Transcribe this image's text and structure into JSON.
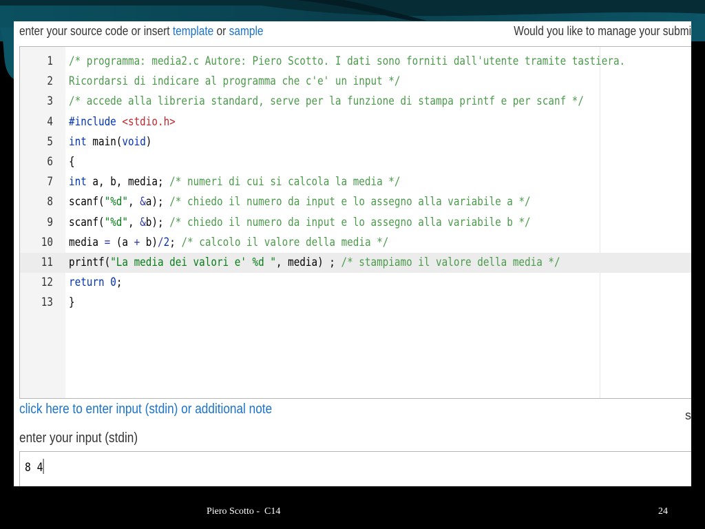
{
  "colors": {
    "background": "#000000",
    "slide_teal": "#0c4a5a",
    "link_blue": "#1a73c9",
    "comment_green": "#4a9a4a",
    "keyword_blue": "#0033b3",
    "string_green": "#067d17",
    "header_red": "#c0262d"
  },
  "top_bar": {
    "prefix": "enter your source code or insert ",
    "template_link": "template",
    "or_text": " or ",
    "sample_link": "sample",
    "right_text": "Would you like to manage your submis"
  },
  "editor": {
    "active_line": 11,
    "lines": [
      {
        "num": "1",
        "tokens": [
          {
            "t": "comment",
            "v": "/* programma: media2.c Autore: Piero Scotto. I dati sono forniti dall'utente tramite tastiera."
          }
        ]
      },
      {
        "num": "2",
        "tokens": [
          {
            "t": "comment",
            "v": "Ricordarsi di indicare al programma che c'e' un input */"
          }
        ]
      },
      {
        "num": "3",
        "tokens": [
          {
            "t": "comment",
            "v": "/* accede alla libreria standard, serve per la funzione di stampa printf e per scanf */"
          }
        ]
      },
      {
        "num": "4",
        "tokens": [
          {
            "t": "preproc",
            "v": "#include "
          },
          {
            "t": "header",
            "v": "<stdio.h>"
          }
        ]
      },
      {
        "num": "5",
        "tokens": [
          {
            "t": "type",
            "v": "int"
          },
          {
            "t": "plain",
            "v": " main("
          },
          {
            "t": "type",
            "v": "void"
          },
          {
            "t": "plain",
            "v": ")"
          }
        ]
      },
      {
        "num": "6",
        "tokens": [
          {
            "t": "plain",
            "v": "{"
          }
        ]
      },
      {
        "num": "7",
        "tokens": [
          {
            "t": "type",
            "v": "int"
          },
          {
            "t": "plain",
            "v": " a, b, media; "
          },
          {
            "t": "comment",
            "v": "/* numeri di cui si calcola la media */"
          }
        ]
      },
      {
        "num": "8",
        "tokens": [
          {
            "t": "plain",
            "v": "scanf("
          },
          {
            "t": "string",
            "v": "\"%d\""
          },
          {
            "t": "plain",
            "v": ", "
          },
          {
            "t": "op",
            "v": "&"
          },
          {
            "t": "plain",
            "v": "a); "
          },
          {
            "t": "comment",
            "v": "/* chiedo il numero da input e lo assegno alla variabile a */"
          }
        ]
      },
      {
        "num": "9",
        "tokens": [
          {
            "t": "plain",
            "v": "scanf("
          },
          {
            "t": "string",
            "v": "\"%d\""
          },
          {
            "t": "plain",
            "v": ", "
          },
          {
            "t": "op",
            "v": "&"
          },
          {
            "t": "plain",
            "v": "b); "
          },
          {
            "t": "comment",
            "v": "/* chiedo il numero da input e lo assegno alla variabile b */"
          }
        ]
      },
      {
        "num": "10",
        "tokens": [
          {
            "t": "plain",
            "v": "media "
          },
          {
            "t": "op",
            "v": "="
          },
          {
            "t": "plain",
            "v": " (a "
          },
          {
            "t": "op",
            "v": "+"
          },
          {
            "t": "plain",
            "v": " b)"
          },
          {
            "t": "op",
            "v": "/"
          },
          {
            "t": "number",
            "v": "2"
          },
          {
            "t": "plain",
            "v": "; "
          },
          {
            "t": "comment",
            "v": "/* calcolo il valore della media */"
          }
        ]
      },
      {
        "num": "11",
        "tokens": [
          {
            "t": "plain",
            "v": "printf("
          },
          {
            "t": "string",
            "v": "\"La media dei valori e' %d \""
          },
          {
            "t": "plain",
            "v": ", media) ; "
          },
          {
            "t": "comment",
            "v": "/* stampiamo il valore della media */"
          }
        ]
      },
      {
        "num": "12",
        "tokens": [
          {
            "t": "keyword",
            "v": "return"
          },
          {
            "t": "plain",
            "v": " "
          },
          {
            "t": "number",
            "v": "0"
          },
          {
            "t": "plain",
            "v": ";"
          }
        ]
      },
      {
        "num": "13",
        "tokens": [
          {
            "t": "plain",
            "v": "}"
          }
        ]
      }
    ]
  },
  "stdin": {
    "link_text": "click here to enter input (stdin) or additional note",
    "right_fragment": "s",
    "label": "enter your input (stdin)",
    "value": "8 4"
  },
  "footer": {
    "author": "Piero Scotto -  C14",
    "page_number": "24"
  }
}
